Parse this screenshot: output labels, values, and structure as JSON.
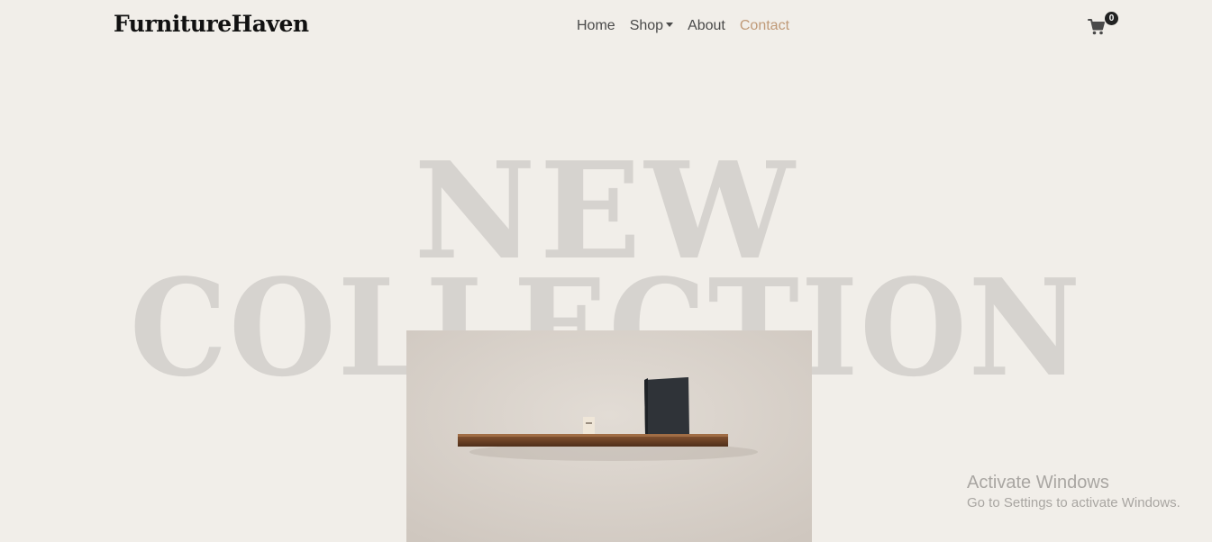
{
  "navbar": {
    "brand": "FurnitureHaven",
    "links": [
      {
        "label": "Home",
        "active": false
      },
      {
        "label": "Shop",
        "active": false,
        "dropdown": true
      },
      {
        "label": "About",
        "active": false
      },
      {
        "label": "Contact",
        "active": true
      }
    ],
    "cart": {
      "icon": "shopping-cart-icon",
      "count": "0"
    }
  },
  "hero": {
    "line1": "NEW",
    "line2": "COLLECTION",
    "image_alt_icon": "wall-shelf-photo"
  },
  "watermark": {
    "title": "Activate Windows",
    "subtitle": "Go to Settings to activate Windows."
  },
  "colors": {
    "background": "#f1eee9",
    "brand_text": "#111111",
    "nav_text": "#4a4a4a",
    "nav_active": "#c09a78",
    "hero_text": "#d6d3cf",
    "badge": "#222222"
  }
}
